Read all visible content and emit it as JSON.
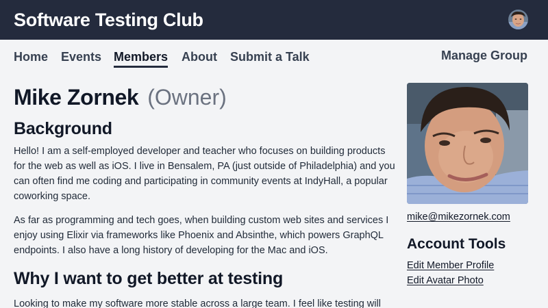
{
  "header": {
    "title": "Software Testing Club",
    "avatar_icon": "user-avatar"
  },
  "nav": {
    "items": [
      {
        "label": "Home",
        "active": false
      },
      {
        "label": "Events",
        "active": false
      },
      {
        "label": "Members",
        "active": true
      },
      {
        "label": "About",
        "active": false
      },
      {
        "label": "Submit a Talk",
        "active": false
      }
    ],
    "manage_label": "Manage Group"
  },
  "profile": {
    "name": "Mike Zornek",
    "role": "(Owner)",
    "background_heading": "Background",
    "background_paragraphs": [
      "Hello! I am a self-employed developer and teacher who focuses on building products for the web as well as iOS. I live in Bensalem, PA (just outside of Philadelphia) and you can often find me coding and participating in community events at IndyHall, a popular coworking space.",
      "As far as programming and tech goes, when building custom web sites and services I enjoy using Elixir via frameworks like Phoenix and Absinthe, which powers GraphQL endpoints. I also have a long history of developing for the Mac and iOS."
    ],
    "why_heading": "Why I want to get better at testing",
    "why_paragraph": "Looking to make my software more stable across a large team. I feel like testing will"
  },
  "sidebar": {
    "email": "mike@mikezornek.com",
    "tools_heading": "Account Tools",
    "tools": [
      "Edit Member Profile",
      "Edit Avatar Photo"
    ]
  },
  "colors": {
    "header_bg": "#242b3d",
    "page_bg": "#f3f4f6",
    "text": "#111827",
    "muted": "#6b7280"
  }
}
